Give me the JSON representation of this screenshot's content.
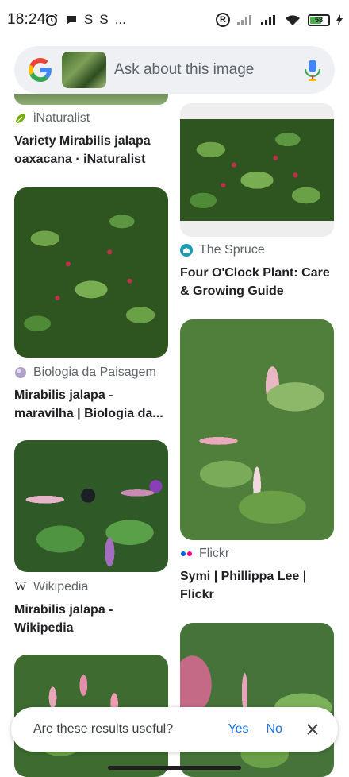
{
  "status_bar": {
    "time": "18:24",
    "left_glyphs": [
      "alarm-icon",
      "chat-bubble-icon",
      "S",
      "S",
      "..."
    ],
    "battery": "58"
  },
  "search": {
    "placeholder": "Ask about this image"
  },
  "results": [
    {
      "source": "iNaturalist",
      "source_icon": "leaf-icon",
      "title": "Variety Mirabilis jalapa oaxacana · iNaturalist"
    },
    {
      "source": "The Spruce",
      "source_icon": "house-icon",
      "title": "Four O'Clock Plant: Care & Growing Guide"
    },
    {
      "source": "Biologia da Paisagem",
      "source_icon": "globe-icon",
      "title": "Mirabilis jalapa - maravilha | Biologia da..."
    },
    {
      "source": "Flickr",
      "source_icon": "flickr-dots-icon",
      "title": "Symi | Phillippa Lee | Flickr"
    },
    {
      "source": "Wikipedia",
      "source_icon": "wikipedia-w-icon",
      "title": "Mirabilis jalapa - Wikipedia"
    }
  ],
  "feedback": {
    "question": "Are these results useful?",
    "yes": "Yes",
    "no": "No"
  },
  "colors": {
    "accent": "#1a73e8",
    "search_bg": "#eef0f3"
  }
}
